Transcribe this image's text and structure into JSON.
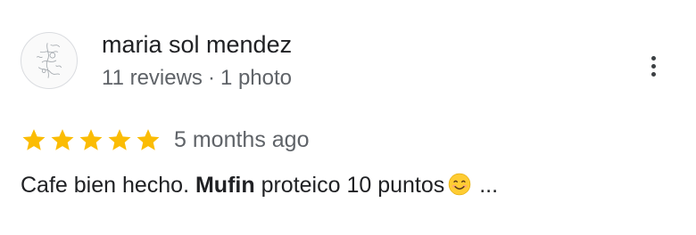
{
  "review": {
    "author": {
      "name": "maria sol mendez",
      "reviews_count": "11 reviews",
      "separator": "·",
      "photos_count": "1 photo"
    },
    "rating": 5,
    "max_rating": 5,
    "time_ago": "5 months ago",
    "text": {
      "part1": "Cafe bien hecho. ",
      "bold": "Mufin",
      "part2": " proteico 10 puntos",
      "emoji": "smiling-face-emoji",
      "ellipsis": " ..."
    }
  },
  "colors": {
    "star": "#fbbc04",
    "meta_text": "#5f6368",
    "primary_text": "#202124"
  },
  "icons": {
    "more": "more-vertical-icon",
    "star": "star-icon"
  }
}
